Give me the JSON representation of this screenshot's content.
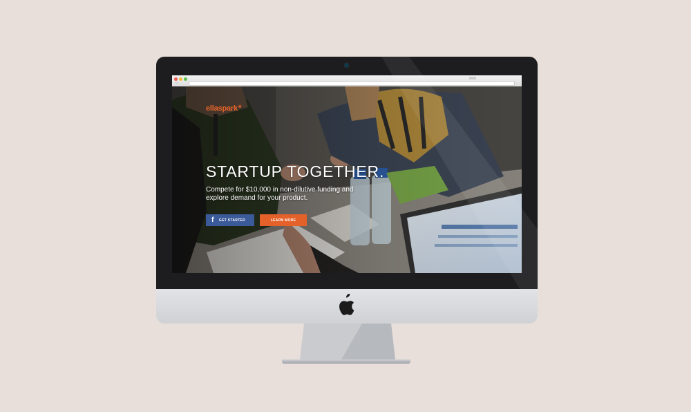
{
  "browser": {
    "address": ""
  },
  "page": {
    "logo_text": "ellaspark",
    "logo_star": "*",
    "headline": "STARTUP TOGETHER.",
    "subline_1": "Compete for $10,000 in non-dilutive funding and",
    "subline_2": "explore demand for your product.",
    "primary_button": "GET STARTED",
    "secondary_button": "LEARN MORE",
    "facebook_icon": "f"
  },
  "colors": {
    "background": "#e8dfda",
    "brand_orange": "#e4612a",
    "facebook_blue": "#3b5a9a",
    "bezel": "#1d1d1f"
  },
  "icons": [
    "facebook-icon",
    "apple-logo-icon",
    "back-arrow-icon",
    "forward-arrow-icon"
  ]
}
